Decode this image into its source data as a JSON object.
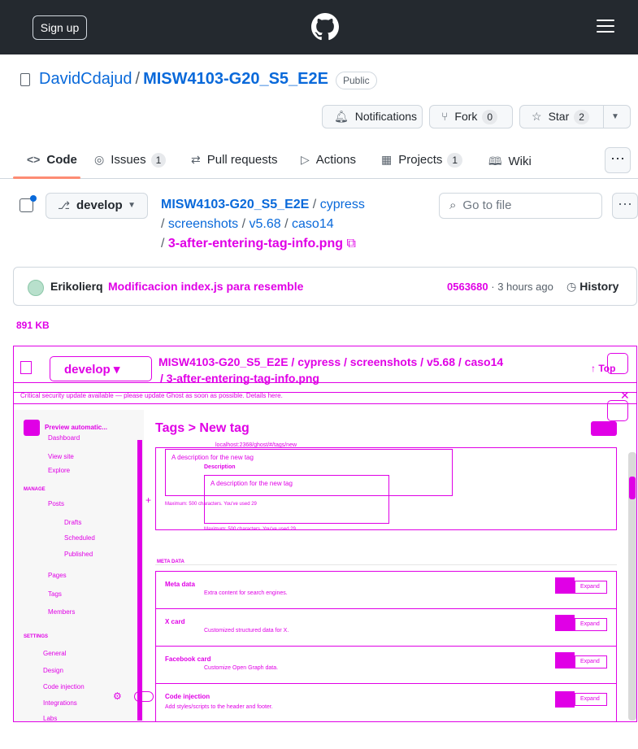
{
  "topbar": {
    "signup_label": "Sign up",
    "logo_icon": "github-logo-icon",
    "menu_icon": "hamburger-menu-icon"
  },
  "repo": {
    "owner": "DavidCdajud",
    "separator": "/",
    "name": "MISW4103-G20_S5_E2E",
    "visibility": "Public",
    "notifications_label": "Notifications",
    "fork_label": "Fork",
    "fork_count": "0",
    "star_label": "Star",
    "star_count": "2"
  },
  "tabs": [
    {
      "label": "Code",
      "icon": "code-icon"
    },
    {
      "label": "Issues",
      "count": "1",
      "icon": "issue-icon"
    },
    {
      "label": "Pull requests",
      "icon": "pull-request-icon"
    },
    {
      "label": "Actions",
      "icon": "play-icon"
    },
    {
      "label": "Projects",
      "count": "1",
      "icon": "table-icon"
    },
    {
      "label": "Wiki",
      "icon": "book-icon"
    }
  ],
  "filebar": {
    "branch": "develop",
    "path_repo": "MISW4103-G20_S5_E2E",
    "path_1": "cypress",
    "path_2": "screenshots",
    "path_3": "v5.68",
    "path_4": "caso14",
    "path_file": "3-after-entering-tag-info.png",
    "goto_placeholder": "Go to file"
  },
  "commit": {
    "author": "Erikolierq",
    "message": "Modificacion index.js para resemble",
    "hash": "0563680",
    "time": "3 hours ago",
    "history_label": "History"
  },
  "file_size": "891 KB",
  "preview": {
    "branch": "develop",
    "path": "MISW4103-G20_S5_E2E / cypress / screenshots / v5.68 / caso14",
    "path_file": "/ 3-after-entering-tag-info.png",
    "top_label": "Top",
    "banner": "Critical security update available — please update Ghost as soon as possible. Details here.",
    "breadcrumb": "Tags  >  New tag",
    "sidebar_items": [
      "Preview automatic...",
      "Dashboard",
      "View site",
      "Explore",
      "Posts",
      "Drafts",
      "Scheduled",
      "Published",
      "Pages",
      "Tags",
      "Members",
      "General",
      "Design",
      "Code injection",
      "Integrations",
      "Labs"
    ],
    "section_manage": "MANAGE",
    "section_settings": "SETTINGS",
    "desc_label": "Description",
    "desc_value": "A description for the new tag",
    "desc_help": "Maximum: 500 characters. You've used 29",
    "slug_hint": "localhost:2368/ghost/#/tags/new",
    "meta_section": "META DATA",
    "cards": [
      {
        "title": "Meta data",
        "sub": "Extra content for search engines.",
        "btn": "Expand"
      },
      {
        "title": "X card",
        "sub": "Customized structured data for X.",
        "btn": "Expand"
      },
      {
        "title": "Facebook card",
        "sub": "Customize Open Graph data.",
        "btn": "Expand"
      },
      {
        "title": "Code injection",
        "sub": "Add styles/scripts to the header and footer.",
        "btn": "Expand"
      }
    ]
  },
  "colors": {
    "header_bg": "#24292f",
    "link": "#0969da",
    "diff_magenta": "#e000e6",
    "tab_underline": "#fd8c73"
  }
}
